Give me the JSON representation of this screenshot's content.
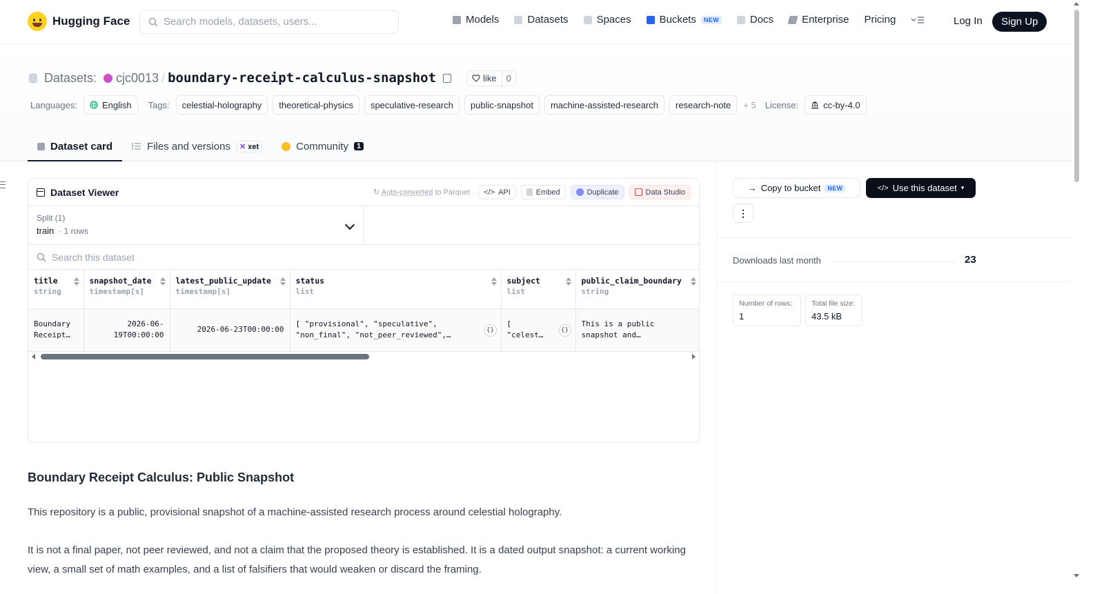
{
  "nav": {
    "brand": "Hugging Face",
    "search_placeholder": "Search models, datasets, users...",
    "links": [
      {
        "label": "Models",
        "icon": "cube-icon",
        "color": "#6b7280"
      },
      {
        "label": "Datasets",
        "icon": "database-icon",
        "color": "#9ca3af"
      },
      {
        "label": "Spaces",
        "icon": "grid-icon",
        "color": "#9ca3af"
      },
      {
        "label": "Buckets",
        "icon": "bucket-icon",
        "color": "#2563eb",
        "badge": "NEW"
      },
      {
        "label": "Docs",
        "icon": "book-icon",
        "color": "#9ca3af"
      },
      {
        "label": "Enterprise",
        "icon": "enterprise-icon",
        "color": "#6b7280"
      },
      {
        "label": "Pricing"
      }
    ],
    "login": "Log In",
    "signup": "Sign Up"
  },
  "header": {
    "section": "Datasets:",
    "owner": "cjc0013",
    "repo": "boundary-receipt-calculus-snapshot",
    "like_label": "like",
    "like_count": "0",
    "languages_label": "Languages:",
    "language": "English",
    "tags_label": "Tags:",
    "tags": [
      "celestial-holography",
      "theoretical-physics",
      "speculative-research",
      "public-snapshot",
      "machine-assisted-research",
      "research-note"
    ],
    "more_tags": "+ 5",
    "license_label": "License:",
    "license": "cc-by-4.0"
  },
  "tabs": {
    "card": "Dataset card",
    "files": "Files and versions",
    "xet": "xet",
    "community": "Community",
    "community_count": "1"
  },
  "viewer": {
    "title": "Dataset Viewer",
    "auto_converted": "Auto-converted",
    "to_parquet": " to Parquet",
    "api": "API",
    "embed": "Embed",
    "duplicate": "Duplicate",
    "studio": "Data Studio",
    "split_label": "Split (1)",
    "split_value": "train",
    "split_rows": "1 rows",
    "search_placeholder": "Search this dataset",
    "columns": [
      {
        "name": "title",
        "type": "string"
      },
      {
        "name": "snapshot_date",
        "type": "timestamp[s]"
      },
      {
        "name": "latest_public_update",
        "type": "timestamp[s]"
      },
      {
        "name": "status",
        "type": "list"
      },
      {
        "name": "subject",
        "type": "list"
      },
      {
        "name": "public_claim_boundary",
        "type": "string"
      }
    ],
    "row": {
      "title": "Boundary Receipt…",
      "snapshot_date": "2026-06-19T00:00:00",
      "latest_public_update": "2026-06-23T00:00:00",
      "status": "[ \"provisional\", \"speculative\", \"non_final\", \"not_peer_reviewed\",…",
      "subject": "[ \"celest…",
      "public_claim_boundary": "This is a public snapshot and…"
    }
  },
  "card": {
    "heading": "Boundary Receipt Calculus: Public Snapshot",
    "p1": "This repository is a public, provisional snapshot of a machine-assisted research process around celestial holography.",
    "p2": "It is not a final paper, not peer reviewed, and not a claim that the proposed theory is established. It is a dated output snapshot: a current working view, a small set of math examples, and a list of falsifiers that would weaken or discard the framing."
  },
  "sidebar": {
    "copy_bucket": "Copy to bucket",
    "new_badge": "NEW",
    "use_dataset": "Use this dataset",
    "downloads_label": "Downloads last month",
    "downloads_value": "23",
    "rows_label": "Number of rows:",
    "rows_value": "1",
    "size_label": "Total file size:",
    "size_value": "43.5 kB"
  }
}
